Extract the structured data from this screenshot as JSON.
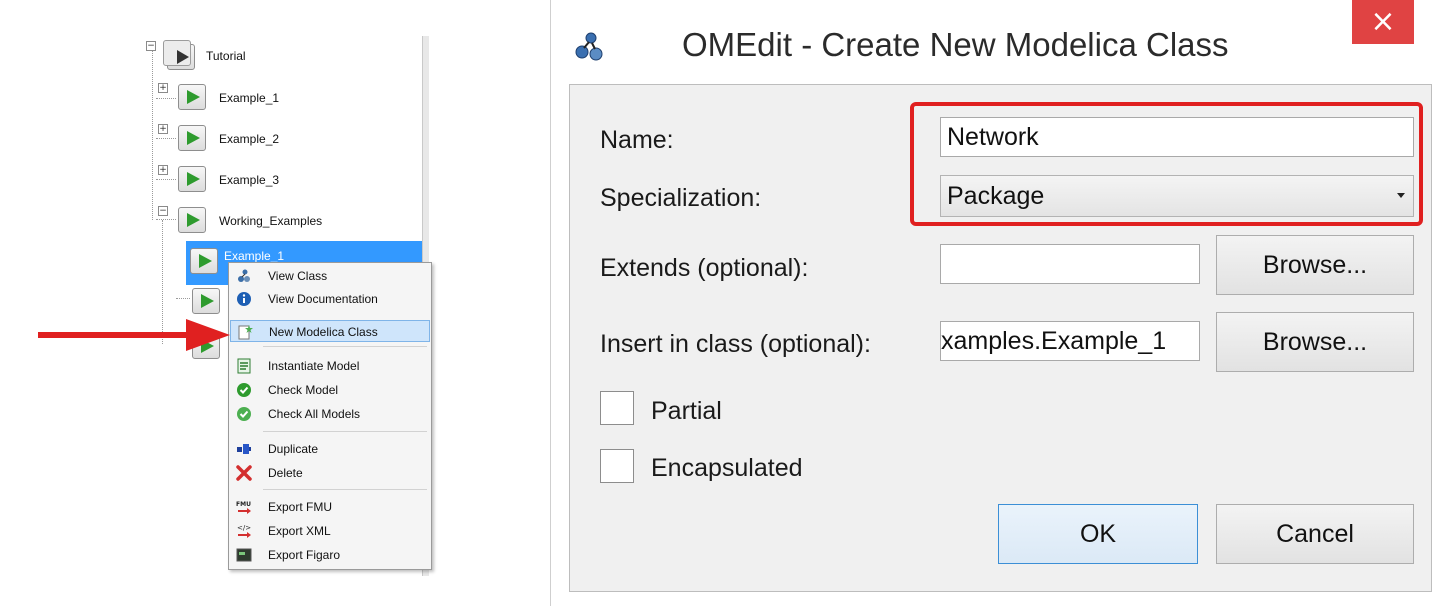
{
  "tree": {
    "root": {
      "label": "Tutorial",
      "expander": "−"
    },
    "items": [
      {
        "label": "Example_1",
        "expander": "+"
      },
      {
        "label": "Example_2",
        "expander": "+"
      },
      {
        "label": "Example_3",
        "expander": "+"
      },
      {
        "label": "Working_Examples",
        "expander": "−"
      }
    ],
    "selected_child_label": "Example_1"
  },
  "context_menu": {
    "items": [
      {
        "label": "View Class",
        "icon": "view-class-icon"
      },
      {
        "label": "View Documentation",
        "icon": "info-icon"
      },
      {
        "label": "New Modelica Class",
        "icon": "new-class-icon",
        "highlighted": true
      },
      {
        "label": "Instantiate Model",
        "icon": "instantiate-icon"
      },
      {
        "label": "Check Model",
        "icon": "check-icon"
      },
      {
        "label": "Check All Models",
        "icon": "check-all-icon"
      },
      {
        "label": "Duplicate",
        "icon": "duplicate-icon"
      },
      {
        "label": "Delete",
        "icon": "delete-icon"
      },
      {
        "label": "Export FMU",
        "icon": "export-fmu-icon"
      },
      {
        "label": "Export XML",
        "icon": "export-xml-icon"
      },
      {
        "label": "Export Figaro",
        "icon": "export-figaro-icon"
      }
    ]
  },
  "dialog": {
    "title": "OMEdit - Create New Modelica Class",
    "close_symbol": "×",
    "name_label": "Name:",
    "name_value": "Network",
    "specialization_label": "Specialization:",
    "specialization_value": "Package",
    "extends_label": "Extends (optional):",
    "extends_value": "",
    "insert_label": "Insert in class (optional):",
    "insert_value": "xamples.Example_1",
    "browse_label": "Browse...",
    "partial_label": "Partial",
    "encapsulated_label": "Encapsulated",
    "ok_label": "OK",
    "cancel_label": "Cancel"
  },
  "colors": {
    "selection": "#3399ff",
    "annotation_red": "#e02020",
    "close_button": "#e04343",
    "play_green": "#2e9b2e"
  }
}
